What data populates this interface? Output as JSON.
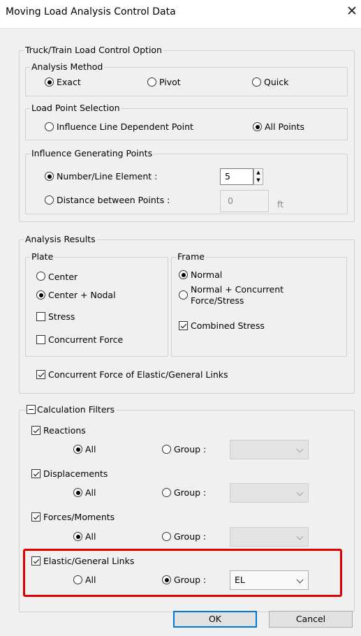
{
  "window": {
    "title": "Moving Load Analysis Control Data",
    "close_glyph": "✕"
  },
  "truck": {
    "legend": "Truck/Train Load Control Option",
    "method": {
      "legend": "Analysis Method",
      "options": [
        {
          "label": "Exact",
          "selected": true
        },
        {
          "label": "Pivot",
          "selected": false
        },
        {
          "label": "Quick",
          "selected": false
        }
      ]
    },
    "load_point": {
      "legend": "Load Point Selection",
      "options": [
        {
          "label": "Influence Line Dependent Point",
          "selected": false
        },
        {
          "label": "All Points",
          "selected": true
        }
      ]
    },
    "influence": {
      "legend": "Influence Generating Points",
      "number_label": "Number/Line Element :",
      "number_selected": true,
      "number_value": "5",
      "distance_label": "Distance between Points :",
      "distance_selected": false,
      "distance_value": "0",
      "distance_unit": "ft"
    }
  },
  "results": {
    "legend": "Analysis Results",
    "plate": {
      "legend": "Plate",
      "center": "Center",
      "center_nodal": "Center + Nodal",
      "selected": "center_nodal",
      "stress": "Stress",
      "stress_checked": false,
      "concurrent": "Concurrent Force",
      "concurrent_checked": false
    },
    "frame": {
      "legend": "Frame",
      "normal": "Normal",
      "normal_concurrent_line1": "Normal + Concurrent",
      "normal_concurrent_line2": "Force/Stress",
      "selected": "normal",
      "combined": "Combined Stress",
      "combined_checked": true
    },
    "elastic_links": "Concurrent Force of Elastic/General Links",
    "elastic_links_checked": true
  },
  "filters": {
    "legend": "Calculation Filters",
    "all_label": "All",
    "group_label": "Group :",
    "rows": [
      {
        "label": "Reactions",
        "checked": true,
        "mode": "all",
        "group": ""
      },
      {
        "label": "Displacements",
        "checked": true,
        "mode": "all",
        "group": ""
      },
      {
        "label": "Forces/Moments",
        "checked": true,
        "mode": "all",
        "group": ""
      },
      {
        "label": "Elastic/General Links",
        "checked": true,
        "mode": "group",
        "group": "EL"
      }
    ]
  },
  "buttons": {
    "ok": "OK",
    "cancel": "Cancel"
  },
  "colors": {
    "highlight": "#e00000",
    "default_button_border": "#0078d7"
  }
}
